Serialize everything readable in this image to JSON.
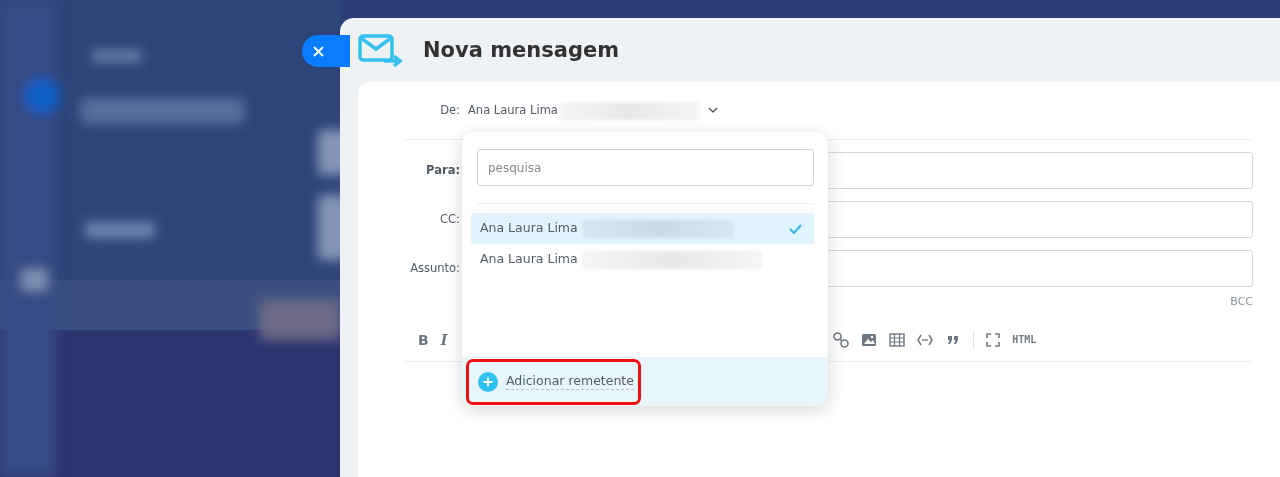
{
  "window": {
    "title": "Nova mensagem"
  },
  "from": {
    "label": "De:",
    "name": "Ana Laura Lima"
  },
  "fields": [
    {
      "label": "Para:",
      "required": true
    },
    {
      "label": "CC:",
      "required": false
    },
    {
      "label": "Assunto:",
      "required": false
    }
  ],
  "bcc_link": "BCC",
  "toolbar": {
    "format_buttons": [
      "B",
      "I"
    ],
    "html_button": "HTML"
  },
  "sender_menu": {
    "search": {
      "placeholder": "pesquisa"
    },
    "senders": [
      {
        "name": "Ana Laura Lima",
        "selected": true
      },
      {
        "name": "Ana Laura Lima",
        "selected": false
      }
    ],
    "add_button": {
      "label": "Adicionar remetente",
      "highlighted": true
    }
  }
}
